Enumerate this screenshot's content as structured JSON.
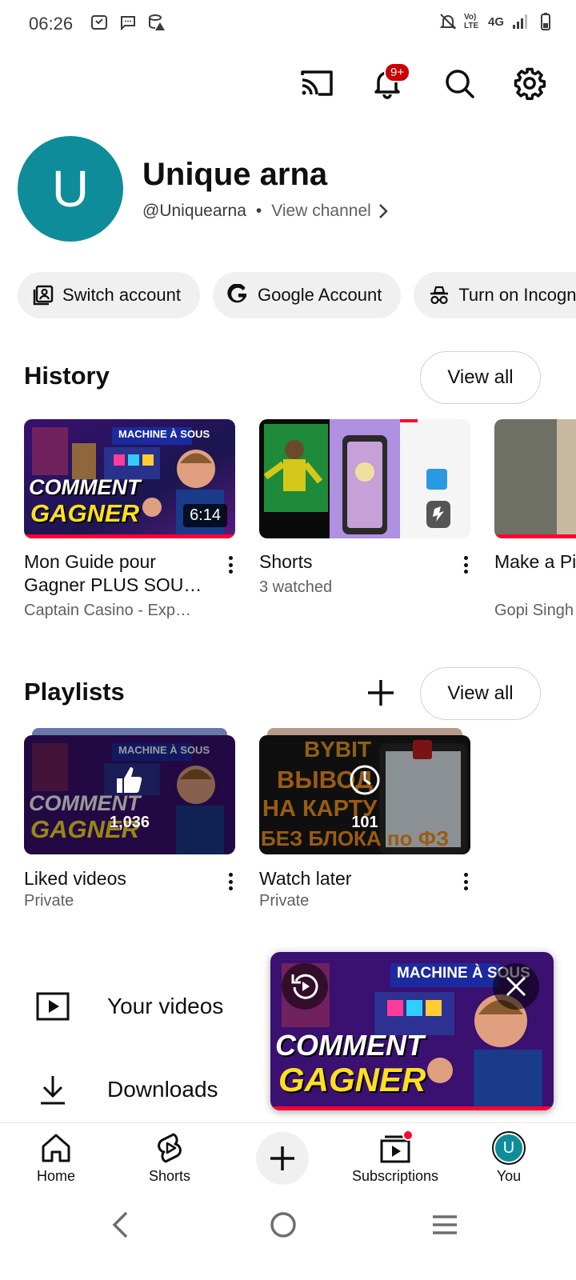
{
  "status_bar": {
    "time": "06:26",
    "network": "4G",
    "volte": "Vo) LTE"
  },
  "top_bar": {
    "notification_badge": "9+",
    "icons": [
      "cast-icon",
      "bell-icon",
      "search-icon",
      "gear-icon"
    ]
  },
  "profile": {
    "avatar_letter": "U",
    "avatar_color": "#0e8c99",
    "name": "Unique arna",
    "handle": "@Uniquearna",
    "separator": "•",
    "view_channel": "View channel"
  },
  "chips": [
    {
      "label": "Switch account",
      "icon": "switch-account-icon"
    },
    {
      "label": "Google Account",
      "icon": "google-g-icon"
    },
    {
      "label": "Turn on Incognito",
      "icon": "incognito-icon"
    }
  ],
  "history": {
    "title": "History",
    "view_all": "View all",
    "items": [
      {
        "title": "Mon Guide pour Gagner PLUS SOU…",
        "channel": "Captain Casino - Exp…",
        "duration": "6:14",
        "thumb_title1": "COMMENT",
        "thumb_title2": "GAGNER",
        "thumb_banner": "MACHINE À SOUS"
      },
      {
        "title": "Shorts",
        "channel": "3 watched"
      },
      {
        "title": "Make a Picture in…",
        "channel": "Gopi Singh"
      }
    ]
  },
  "playlists": {
    "title": "Playlists",
    "view_all": "View all",
    "items": [
      {
        "title": "Liked videos",
        "privacy": "Private",
        "count": "1,036",
        "thumb_title1": "COMMENT",
        "thumb_title2": "GAGNER",
        "thumb_banner": "MACHINE À SOUS"
      },
      {
        "title": "Watch later",
        "privacy": "Private",
        "count": "101",
        "thumb_line0": "BYBIT",
        "thumb_line1": "ВЫВОД",
        "thumb_line2": "НА КАРТУ",
        "thumb_line3": "БЕЗ БЛОКА по ФЗ"
      }
    ]
  },
  "menu": [
    {
      "label": "Your videos",
      "icon": "play-box-icon"
    },
    {
      "label": "Downloads",
      "icon": "download-icon"
    }
  ],
  "miniplayer": {
    "title1": "COMMENT",
    "title2": "GAGNER",
    "banner": "MACHINE À SOUS"
  },
  "bottom_nav": {
    "home": "Home",
    "shorts": "Shorts",
    "subscriptions": "Subscriptions",
    "you": "You",
    "you_avatar_letter": "U"
  },
  "colors": {
    "accent_red": "#ff0033",
    "badge_red": "#cc0000",
    "avatar_teal": "#0e8c99"
  }
}
